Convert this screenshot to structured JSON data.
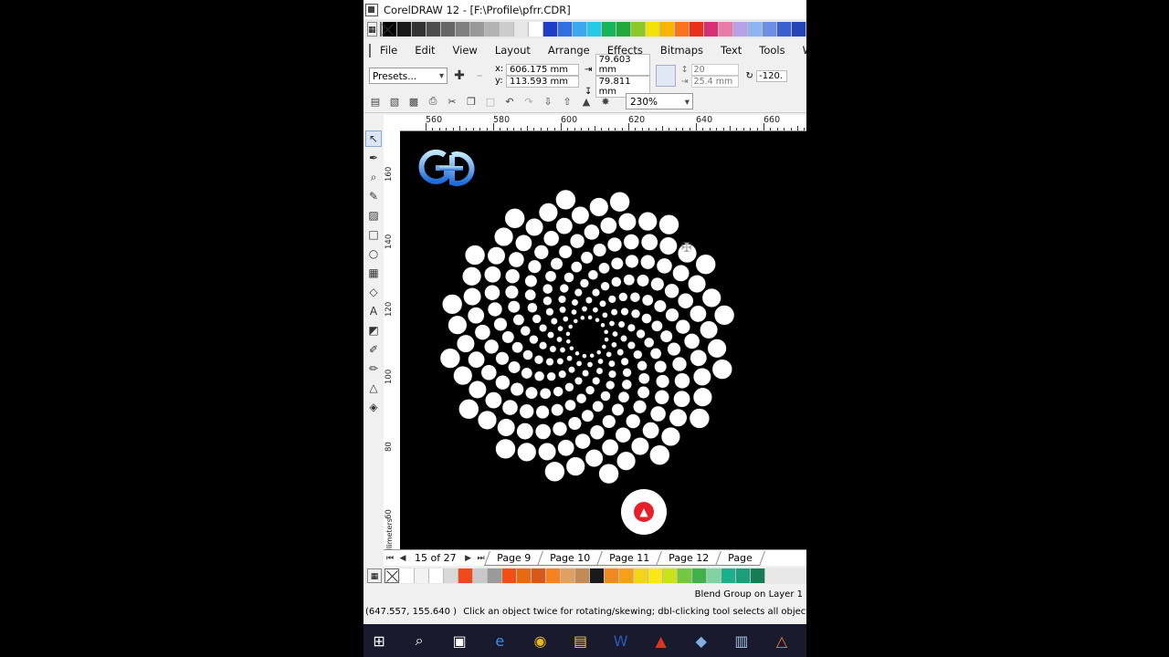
{
  "window": {
    "title": "CorelDRAW 12 - [F:\\Profile\\pfrr.CDR]"
  },
  "menu": [
    "File",
    "Edit",
    "View",
    "Layout",
    "Arrange",
    "Effects",
    "Bitmaps",
    "Text",
    "Tools",
    "Wi"
  ],
  "property_bar": {
    "presets": "Presets...",
    "x_value": "606.175 mm",
    "y_value": "113.593 mm",
    "x_label": "x:",
    "y_label": "y:",
    "width_value": "79.603 mm",
    "height_value": "79.811 mm",
    "scale_top": "20",
    "scale_bottom": "25.4 mm",
    "rotation": "-120."
  },
  "standard_bar": {
    "zoom": "230%"
  },
  "rulers": {
    "h_labels": [
      "560",
      "580",
      "600",
      "620",
      "640",
      "660"
    ],
    "v_labels": [
      "160",
      "140",
      "120",
      "100",
      "80",
      "60"
    ],
    "unit": "millimeters"
  },
  "page_nav": {
    "counter": "15 of 27",
    "tabs": [
      "Page 9",
      "Page 10",
      "Page 11",
      "Page 12",
      "Page"
    ]
  },
  "status": {
    "selection": "Blend Group on Layer 1",
    "cursor": "(647.557, 155.640 )",
    "hint": "Click an object twice for rotating/skewing; dbl-clicking tool selects all objects; Shift+"
  },
  "colors": {
    "top_palette": [
      "#000000",
      "#1a1a1a",
      "#333333",
      "#4d4d4d",
      "#666666",
      "#808080",
      "#999999",
      "#b3b3b3",
      "#cccccc",
      "#e6e6e6",
      "#ffffff",
      "#1f3ec8",
      "#2f6fe0",
      "#3aa7f0",
      "#25c9e8",
      "#16b55b",
      "#1fa93a",
      "#8ac926",
      "#f2e205",
      "#f7b500",
      "#f7731c",
      "#e8311c",
      "#d62f74",
      "#e87aa7",
      "#b6a0e6",
      "#8fb4ef",
      "#6a8fe4",
      "#3a5fd0",
      "#2346b5"
    ],
    "bottom_palette": [
      "#ffffff",
      "#f2f2f2",
      "#ffffff",
      "#d9d9d9",
      "#f04a1c",
      "#c8c8c8",
      "#9a9a9a",
      "#f24f12",
      "#e66a10",
      "#d8581a",
      "#f5821f",
      "#e0a060",
      "#c28b54",
      "#1a1a1a",
      "#f08a1e",
      "#f6a01a",
      "#f4d31a",
      "#f8e81a",
      "#c9e21c",
      "#72c83e",
      "#3fb34a",
      "#80d4a2",
      "#1bb08c",
      "#1a9f7a",
      "#167c54"
    ]
  },
  "icons": {
    "tools": [
      "pick-tool-icon",
      "shape-tool-icon",
      "zoom-tool-icon",
      "freehand-tool-icon",
      "smart-fill-icon",
      "rectangle-tool-icon",
      "ellipse-tool-icon",
      "graph-paper-icon",
      "basic-shapes-icon",
      "text-tool-icon",
      "interactive-blend-icon",
      "eyedropper-icon",
      "outline-tool-icon",
      "fill-tool-icon",
      "interactive-fill-icon"
    ],
    "taskbar": [
      "windows-start-icon",
      "search-icon",
      "task-view-icon",
      "edge-icon",
      "chrome-icon",
      "file-explorer-icon",
      "word-icon",
      "acrobat-icon",
      "coreldraw-icon",
      "app-icon",
      "vlc-icon"
    ]
  }
}
